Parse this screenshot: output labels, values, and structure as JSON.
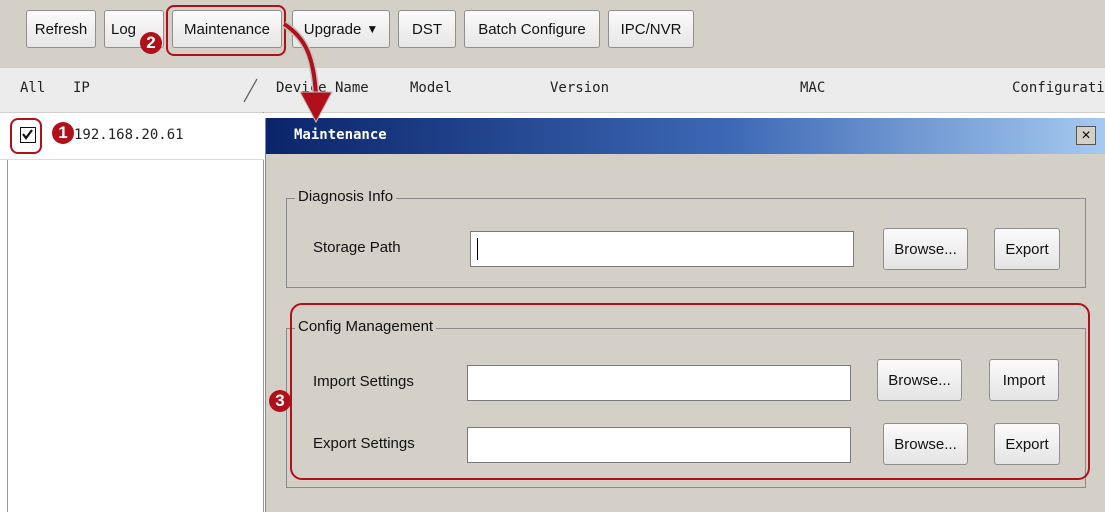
{
  "toolbar": {
    "refresh": "Refresh",
    "log": "Log",
    "maintenance": "Maintenance",
    "upgrade": "Upgrade",
    "upgrade_arrow": "▼",
    "dst": "DST",
    "batch_configure": "Batch Configure",
    "ipc_nvr": "IPC/NVR"
  },
  "table": {
    "headers": {
      "all": "All",
      "ip": "IP",
      "device_name": "Device Name",
      "model": "Model",
      "version": "Version",
      "mac": "MAC",
      "configuration": "Configurati"
    },
    "rows": [
      {
        "checked": true,
        "ip": "192.168.20.61"
      }
    ]
  },
  "dialog": {
    "title": "Maintenance",
    "close": "×",
    "diagnosis": {
      "legend": "Diagnosis Info",
      "storage_path_label": "Storage Path",
      "storage_path_value": "",
      "browse": "Browse...",
      "export": "Export"
    },
    "config": {
      "legend": "Config Management",
      "import_label": "Import Settings",
      "import_value": "",
      "import_browse": "Browse...",
      "import_button": "Import",
      "export_label": "Export Settings",
      "export_value": "",
      "export_browse": "Browse...",
      "export_button": "Export"
    }
  },
  "annotations": {
    "step1": "1",
    "step2": "2",
    "step3": "3"
  },
  "colors": {
    "annotation_red": "#b0101a",
    "title_blue": "#0a246a"
  }
}
